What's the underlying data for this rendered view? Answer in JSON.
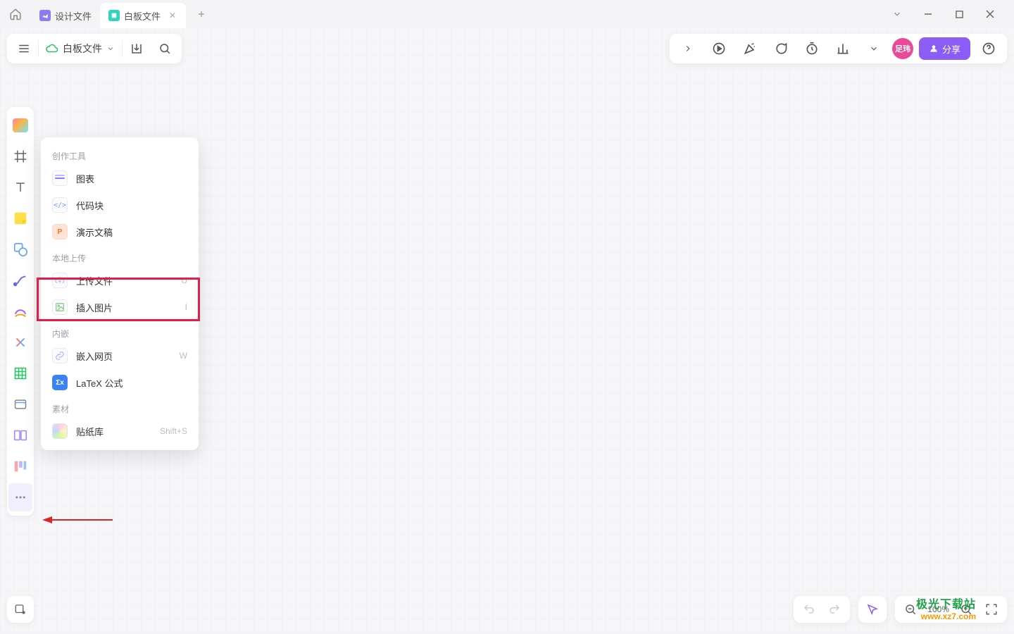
{
  "tabs": {
    "items": [
      {
        "label": "设计文件",
        "active": false
      },
      {
        "label": "白板文件",
        "active": true
      }
    ]
  },
  "fileMenu": {
    "fileName": "白板文件"
  },
  "topRight": {
    "avatarText": "足玮",
    "shareLabel": "分享"
  },
  "popover": {
    "section_creative": "创作工具",
    "section_upload": "本地上传",
    "section_embed": "内嵌",
    "section_assets": "素材",
    "items": {
      "chart": "图表",
      "codeblock": "代码块",
      "presentation": "演示文稿",
      "uploadFile": {
        "label": "上传文件",
        "shortcut": "U"
      },
      "insertImage": {
        "label": "插入图片",
        "shortcut": "I"
      },
      "embedWeb": {
        "label": "嵌入网页",
        "shortcut": "W"
      },
      "latex": "LaTeX 公式",
      "stickers": {
        "label": "贴纸库",
        "shortcut": "Shift+S"
      }
    }
  },
  "zoom": {
    "label": "100%"
  },
  "watermark": {
    "line1": "极光下载站",
    "line2": "www.xz7.com"
  }
}
